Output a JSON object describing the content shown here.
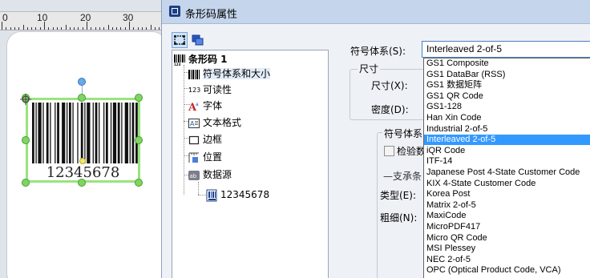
{
  "ruler": {
    "labels": [
      "0",
      "10",
      "20",
      "30"
    ]
  },
  "barcode": {
    "text": "12345678"
  },
  "dialog": {
    "title": "条形码属性",
    "tree": {
      "root": "条形码 1",
      "items": [
        "符号体系和大小",
        "可读性",
        "字体",
        "文本格式",
        "边框",
        "位置",
        "数据源"
      ],
      "data_child": "12345678"
    },
    "icons": {
      "readability": "123"
    },
    "props": {
      "symbology_label": "符号体系(S):",
      "symbology_value": "Interleaved 2-of-5",
      "size_group": "尺寸",
      "size_label": "尺寸(X):",
      "density_label": "密度(D):",
      "symbology_group": "符号体系",
      "check_label": "检验数",
      "support_label": "支承条",
      "type_label": "类型(E):",
      "thickness_label": "粗细(N):"
    },
    "dropdown": {
      "items": [
        "GS1 Composite",
        "GS1 DataBar (RSS)",
        "GS1 数据矩阵",
        "GS1 QR Code",
        "GS1-128",
        "Han Xin Code",
        "Industrial 2-of-5",
        "Interleaved 2-of-5",
        "iQR Code",
        "ITF-14",
        "Japanese Post 4-State Customer Code",
        "KIX 4-State Customer Code",
        "Korea Post",
        "Matrix 2-of-5",
        "MaxiCode",
        "MicroPDF417",
        "Micro QR Code",
        "MSI Plessey",
        "NEC 2-of-5",
        "OPC (Optical Product Code, VCA)"
      ],
      "selected_index": 7
    }
  }
}
